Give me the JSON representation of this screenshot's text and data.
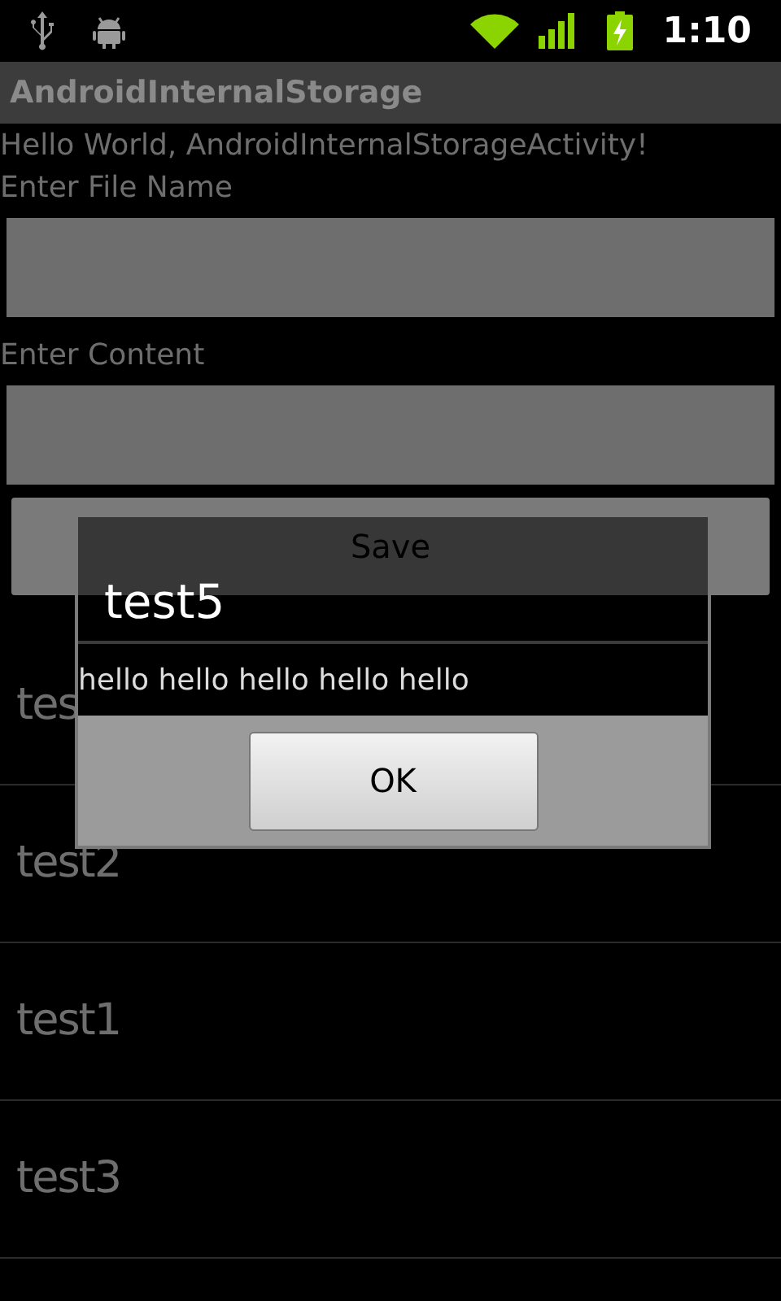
{
  "status_bar": {
    "time": "1:10"
  },
  "app_bar": {
    "title": "AndroidInternalStorage"
  },
  "greeting": "Hello World, AndroidInternalStorageActivity!",
  "fields": [
    {
      "label": "Enter File Name"
    },
    {
      "label": "Enter Content"
    }
  ],
  "save_button": "Save",
  "files": [
    "tes",
    "test2",
    "test1",
    "test3"
  ],
  "dialog": {
    "title": "test5",
    "message": "hello hello hello hello hello",
    "button": "OK"
  }
}
